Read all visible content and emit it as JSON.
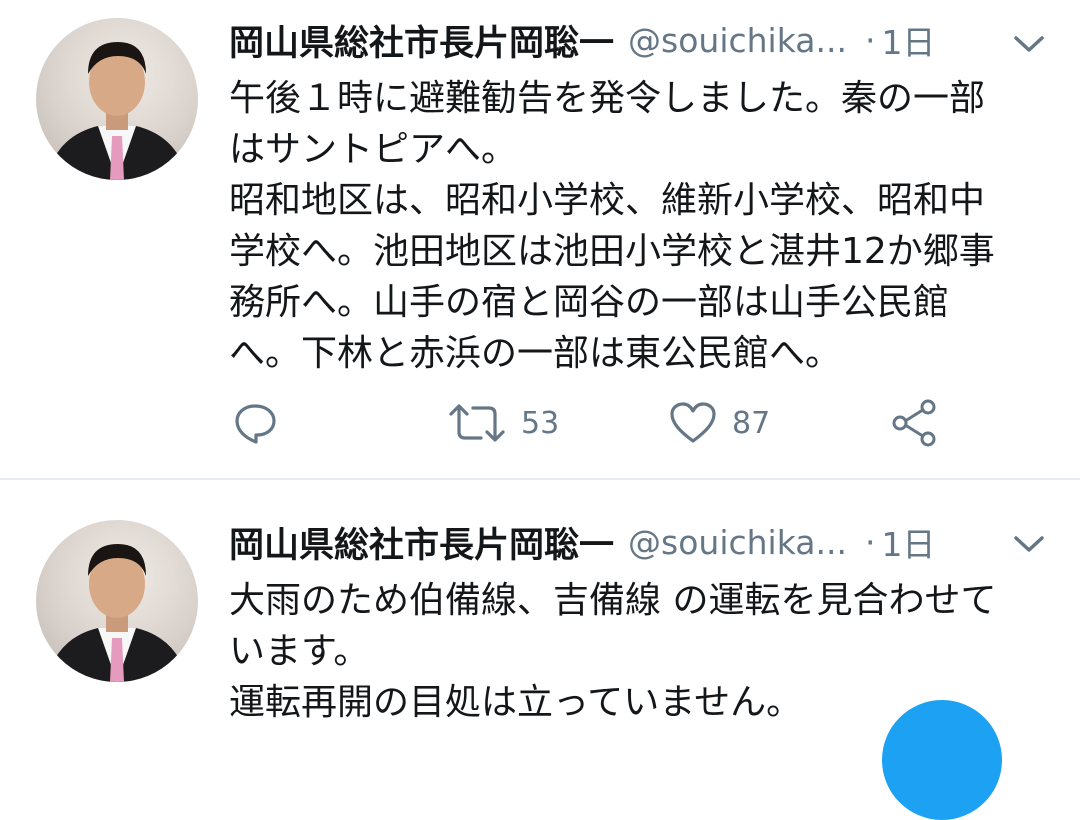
{
  "tweets": [
    {
      "name": "岡山県総社市長片岡聡一",
      "handle": "@souichika...",
      "dot": "·",
      "time": "1日",
      "lines": [
        "午後１時に避難勧告を発令しました。秦の一部",
        "はサントピアへ。",
        "昭和地区は、昭和小学校、維新小学校、昭和中",
        "学校へ。池田地区は池田小学校と湛井12か郷事",
        "務所へ。山手の宿と岡谷の一部は山手公民館",
        "へ。下林と赤浜の一部は東公民館へ。"
      ],
      "actions": {
        "retweets": "53",
        "likes": "87"
      }
    },
    {
      "name": "岡山県総社市長片岡聡一",
      "handle": "@souichika...",
      "dot": "·",
      "time": "1日",
      "lines": [
        "大雨のため伯備線、吉備線 の運転を見合わせて",
        "います。",
        "運転再開の目処は立っていません。"
      ]
    }
  ],
  "icons": {
    "reply": "reply-icon",
    "retweet": "retweet-icon",
    "like": "heart-icon",
    "share": "share-icon",
    "more": "chevron-down-icon",
    "compose": "compose-fab"
  },
  "colors": {
    "text": "#14171a",
    "secondary": "#657786",
    "divider": "#e6ecf0",
    "accent": "#1da1f2"
  }
}
